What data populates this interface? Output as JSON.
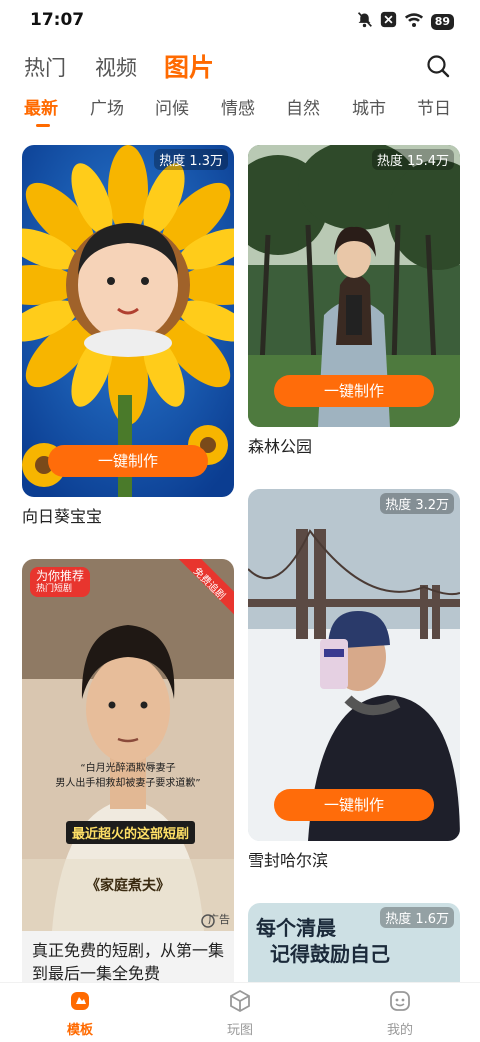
{
  "status_bar": {
    "time": "17:07",
    "battery": "89",
    "icons": [
      "mute-icon",
      "close-icon",
      "wifi-icon",
      "battery-icon"
    ]
  },
  "top_tabs": [
    {
      "label": "热门",
      "active": false
    },
    {
      "label": "视频",
      "active": false
    },
    {
      "label": "图片",
      "active": true
    }
  ],
  "sub_tabs": [
    {
      "label": "最新",
      "active": true
    },
    {
      "label": "广场",
      "active": false
    },
    {
      "label": "问候",
      "active": false
    },
    {
      "label": "情感",
      "active": false
    },
    {
      "label": "自然",
      "active": false
    },
    {
      "label": "城市",
      "active": false
    },
    {
      "label": "节日",
      "active": false
    }
  ],
  "make_label": "一键制作",
  "cards": {
    "sunflower": {
      "heat": "热度 1.3万",
      "caption": "向日葵宝宝"
    },
    "forest": {
      "heat": "热度 15.4万",
      "caption": "森林公园"
    },
    "ad": {
      "badge": "为你推荐",
      "badge_sub": "热门短剧",
      "corner_tag": "免费追剧",
      "ad_label": "广告",
      "subtitle_line1": "“白月光醉酒欺辱妻子",
      "subtitle_line2": "男人出手相救却被妻子要求道歉”",
      "banner": "最近超火的这部短剧",
      "drama_title": "《家庭煮夫》",
      "caption": "真正免费的短剧，从第一集到最后一集全免费"
    },
    "harbin": {
      "heat": "热度 3.2万",
      "caption": "雪封哈尔滨"
    },
    "morning": {
      "heat": "热度 1.6万",
      "text_line1": "每个清晨",
      "text_line2": "记得鼓励自己"
    }
  },
  "bottom_nav": [
    {
      "label": "模板",
      "icon": "template-icon",
      "active": true
    },
    {
      "label": "玩图",
      "icon": "cube-icon",
      "active": false
    },
    {
      "label": "我的",
      "icon": "profile-icon",
      "active": false
    }
  ],
  "colors": {
    "accent": "#ff6a00",
    "button": "#ff6c0a"
  }
}
